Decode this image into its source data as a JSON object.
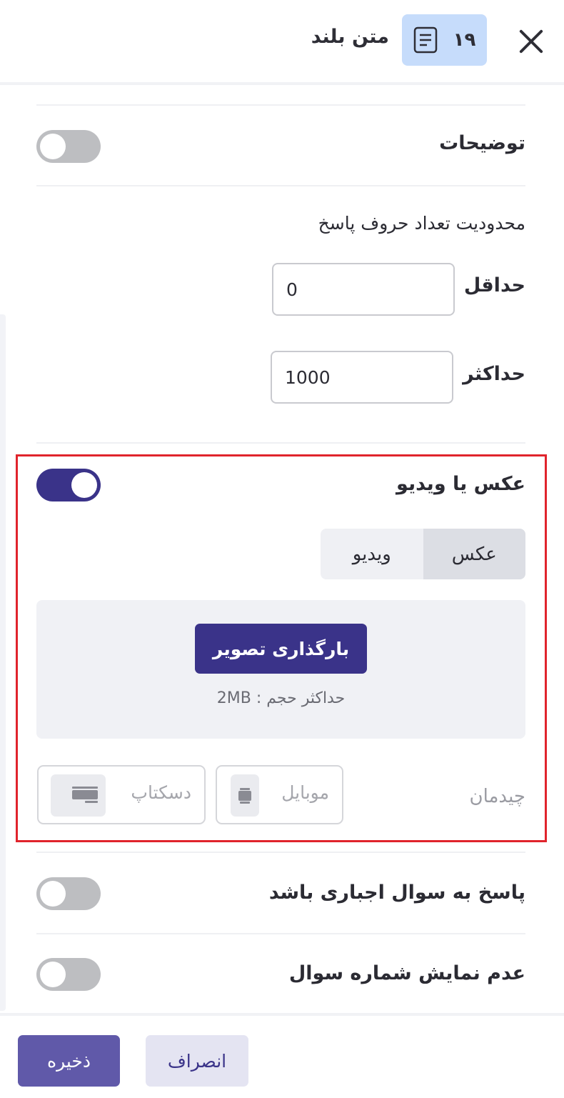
{
  "header": {
    "question_number": "۱۹",
    "question_type": "متن بلند",
    "doc_icon": "document-lines-icon",
    "close_icon": "close-icon",
    "badge_color": "#c6dcfb"
  },
  "description_row": {
    "label": "توضیحات",
    "enabled": false
  },
  "char_limit": {
    "title": "محدودیت تعداد حروف پاسخ",
    "min_label": "حداقل",
    "min_value": "0",
    "max_label": "حداکثر",
    "max_value": "1000"
  },
  "media_row": {
    "label": "عکس یا ویدیو",
    "enabled": true,
    "tabs": [
      {
        "label": "عکس",
        "active": true
      },
      {
        "label": "ویدیو",
        "active": false
      }
    ],
    "upload_button": "بارگذاری تصویر",
    "upload_hint": "حداکثر حجم : 2MB",
    "layout_label": "چیدمان",
    "layout_options": [
      {
        "label": "موبایل",
        "icon": "mobile-icon"
      },
      {
        "label": "دسکتاپ",
        "icon": "desktop-icon"
      }
    ]
  },
  "required_row": {
    "label": "پاسخ به سوال اجباری باشد",
    "enabled": false
  },
  "hide_number_row": {
    "label": "عدم نمایش شماره سوال",
    "enabled": false
  },
  "footer": {
    "save_label": "ذخیره",
    "cancel_label": "انصراف"
  },
  "colors": {
    "accent": "#3a3389",
    "highlight": "#e0242c",
    "toggle_off": "#bdbec1"
  }
}
